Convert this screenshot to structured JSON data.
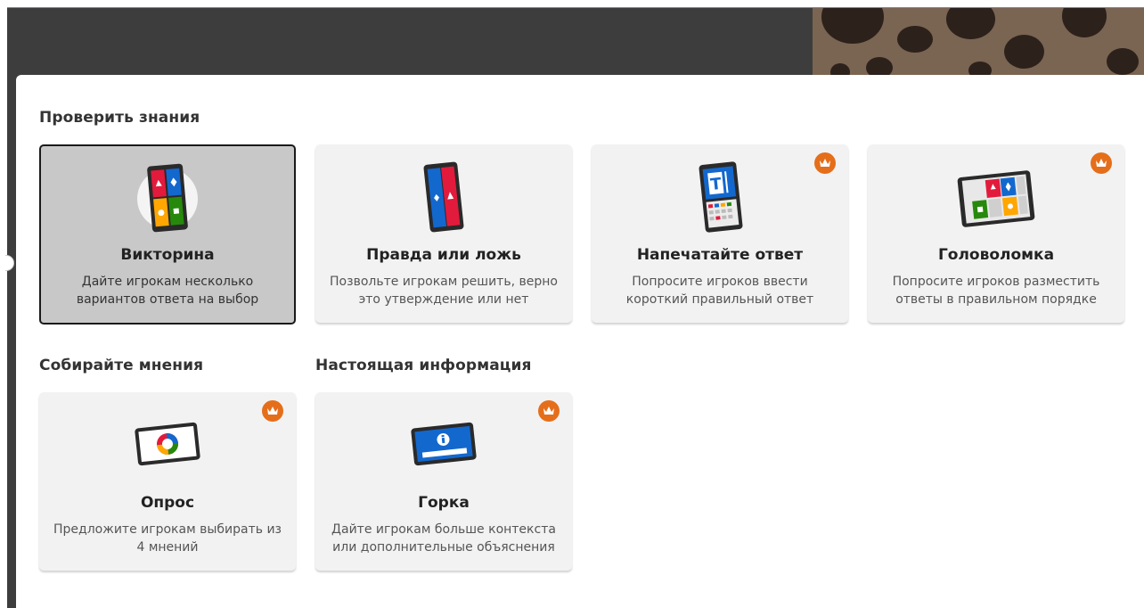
{
  "sections": [
    {
      "title": "Проверить знания"
    },
    {
      "title": "Собирайте мнения"
    },
    {
      "title": "Настоящая информация"
    }
  ],
  "cards": [
    {
      "name": "Викторина",
      "desc": "Дайте игрокам несколько вариантов ответа на выбор",
      "premium": false,
      "selected": true
    },
    {
      "name": "Правда или ложь",
      "desc": "Позвольте игрокам решить, верно это утверждение или нет",
      "premium": false,
      "selected": false
    },
    {
      "name": "Напечатайте ответ",
      "desc": "Попросите игроков ввести короткий правильный ответ",
      "premium": true,
      "selected": false
    },
    {
      "name": "Головоломка",
      "desc": "Попросите игроков разместить ответы в правильном порядке",
      "premium": true,
      "selected": false
    },
    {
      "name": "Опрос",
      "desc": "Предложите игрокам выбирать из 4 мнений",
      "premium": true,
      "selected": false
    },
    {
      "name": "Горка",
      "desc": "Дайте игрокам больше контекста или дополнительные объяснения",
      "premium": true,
      "selected": false
    }
  ],
  "icons": {
    "premium": "crown-icon",
    "quiz": "quiz-tablet-icon",
    "true_false": "true-false-tablet-icon",
    "type_answer": "type-answer-tablet-icon",
    "puzzle": "puzzle-tablet-icon",
    "poll": "poll-tablet-icon",
    "slide": "slide-tablet-icon"
  },
  "colors": {
    "red": "#e21b3c",
    "blue": "#1368ce",
    "yellow": "#ffa602",
    "green": "#26890c",
    "premium": "#e56e1b",
    "selected_bg": "#c8c8c8",
    "card_bg": "#f2f2f2"
  }
}
